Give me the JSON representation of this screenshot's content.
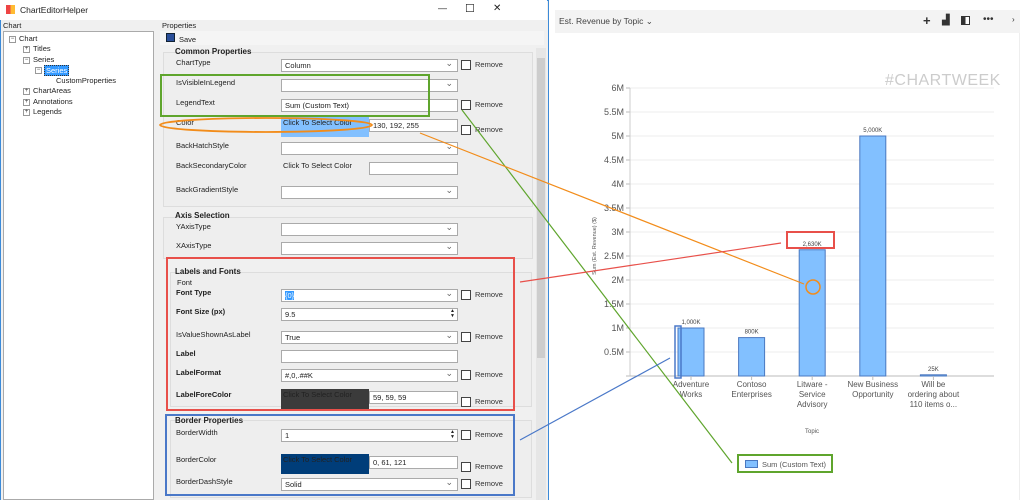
{
  "window": {
    "title": "ChartEditorHelper",
    "minimize": "—",
    "maximize": "☐",
    "close": "✕"
  },
  "tree": {
    "header": "Chart",
    "items": [
      {
        "label": "Chart",
        "expander": "⊟"
      },
      {
        "label": "Titles",
        "expander": "⊞"
      },
      {
        "label": "Series",
        "expander": "⊟"
      },
      {
        "label": "Series",
        "expander": "⊟",
        "selected": true
      },
      {
        "label": "CustomProperties"
      },
      {
        "label": "ChartAreas",
        "expander": "⊞"
      },
      {
        "label": "Annotations",
        "expander": "⊞"
      },
      {
        "label": "Legends",
        "expander": "⊞"
      }
    ]
  },
  "properties": {
    "header": "Properties",
    "save": "Save",
    "remove": "Remove",
    "common": {
      "title": "Common Properties",
      "chart_type": {
        "label": "ChartType",
        "value": "Column"
      },
      "is_visible_in_legend": {
        "label": "IsVisibleInLegend",
        "value": ""
      },
      "legend_text": {
        "label": "LegendText",
        "value": "Sum (Custom Text)"
      },
      "color": {
        "label": "Color",
        "button": "Click To Select Color",
        "value": "130, 192, 255",
        "swatch": "#82c0ff"
      },
      "back_hatch": {
        "label": "BackHatchStyle",
        "value": ""
      },
      "back_secondary": {
        "label": "BackSecondaryColor",
        "button": "Click To Select Color",
        "value": ""
      },
      "back_gradient": {
        "label": "BackGradientStyle",
        "value": ""
      }
    },
    "axis": {
      "title": "Axis Selection",
      "y": {
        "label": "YAxisType",
        "value": ""
      },
      "x": {
        "label": "XAxisType",
        "value": ""
      }
    },
    "labels": {
      "title": "Labels and Fonts",
      "font_group": "Font",
      "font_type": {
        "label": "Font Type",
        "value": "{0}"
      },
      "font_size": {
        "label": "Font Size (px)",
        "value": "9.5"
      },
      "is_value_shown": {
        "label": "IsValueShownAsLabel",
        "value": "True"
      },
      "label": {
        "label": "Label",
        "value": ""
      },
      "label_format": {
        "label": "LabelFormat",
        "value": "#,0,.##K"
      },
      "label_fore_color": {
        "label": "LabelForeColor",
        "button": "Click To Select Color",
        "value": "59, 59, 59",
        "swatch": "#3b3b3b"
      }
    },
    "border": {
      "title": "Border Properties",
      "width": {
        "label": "BorderWidth",
        "value": "1"
      },
      "color": {
        "label": "BorderColor",
        "button": "Click To Select Color",
        "value": "0, 61, 121",
        "swatch": "#003d79"
      },
      "dash": {
        "label": "BorderDashStyle",
        "value": "Solid"
      }
    }
  },
  "chart_panel": {
    "title": "Est. Revenue by Topic",
    "title_chevron": "⌄",
    "watermark": "#CHARTWEEK",
    "icons": [
      "plus-icon",
      "chart-icon",
      "layout-icon",
      "more-icon",
      "chevron-right-icon"
    ]
  },
  "chart_data": {
    "type": "bar",
    "title": "",
    "xlabel": "Topic",
    "ylabel": "Sum (Est. Revenue) ($)",
    "categories": [
      "Adventure Works",
      "Contoso Enterprises",
      "Litware - Service Advisory",
      "New Business Opportunity",
      "Will be ordering about 110 items o..."
    ],
    "values": [
      1000000,
      800000,
      2630000,
      5000000,
      25000
    ],
    "data_labels": [
      "1,000K",
      "800K",
      "2,630K",
      "5,000K",
      "25K"
    ],
    "ylim": [
      0,
      6000000
    ],
    "yticks": [
      "",
      "0.5M",
      "1M",
      "1.5M",
      "2M",
      "2.5M",
      "3M",
      "3.5M",
      "4M",
      "4.5M",
      "5M",
      "5.5M",
      "6M"
    ],
    "grid": true,
    "bar_color": "#82c0ff",
    "bar_border": "#4a78c0",
    "legend": {
      "label": "Sum (Custom Text)",
      "position": "bottom"
    }
  }
}
